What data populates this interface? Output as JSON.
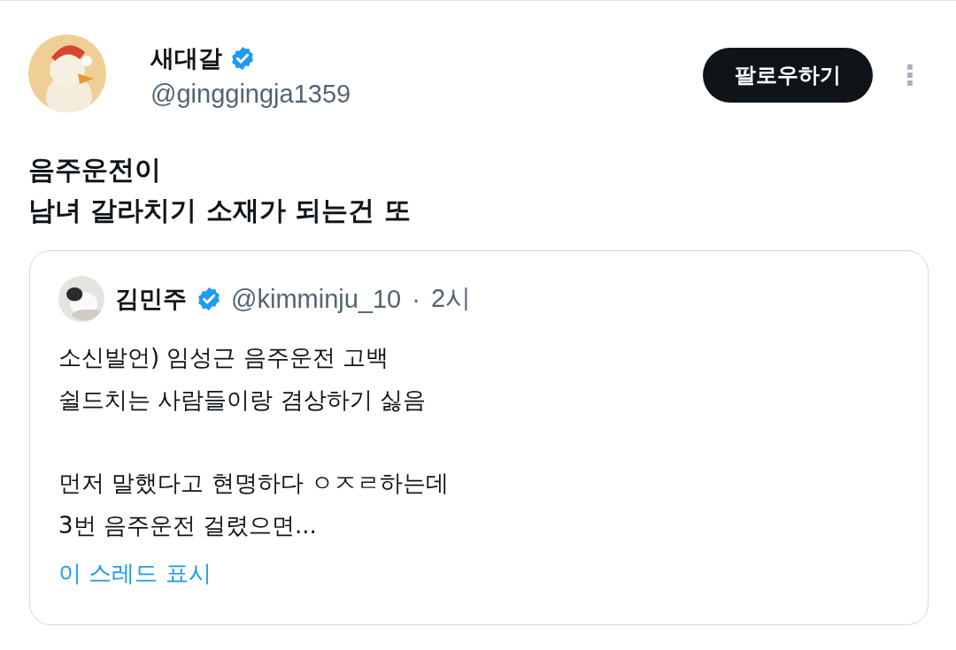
{
  "author": {
    "name": "새대갈",
    "verified": true,
    "handle": "@ginggingja1359"
  },
  "follow_button": "팔로우하기",
  "more_menu": "⋮",
  "text_lines": [
    "음주운전이",
    "남녀 갈라치기 소재가 되는건 또"
  ],
  "quote": {
    "author": {
      "name": "김민주",
      "verified": true,
      "handle": "@kimminju_10"
    },
    "separator": "·",
    "time": "2시",
    "paragraphs": [
      [
        "소신발언) 임성근 음주운전 고백",
        "쉴드치는 사람들이랑 겸상하기 싫음"
      ],
      [
        "먼저 말했다고 현명하다 ㅇㅈㄹ하는데",
        "3번 음주운전 걸렸으면..."
      ]
    ],
    "show_thread": "이 스레드 표시"
  }
}
